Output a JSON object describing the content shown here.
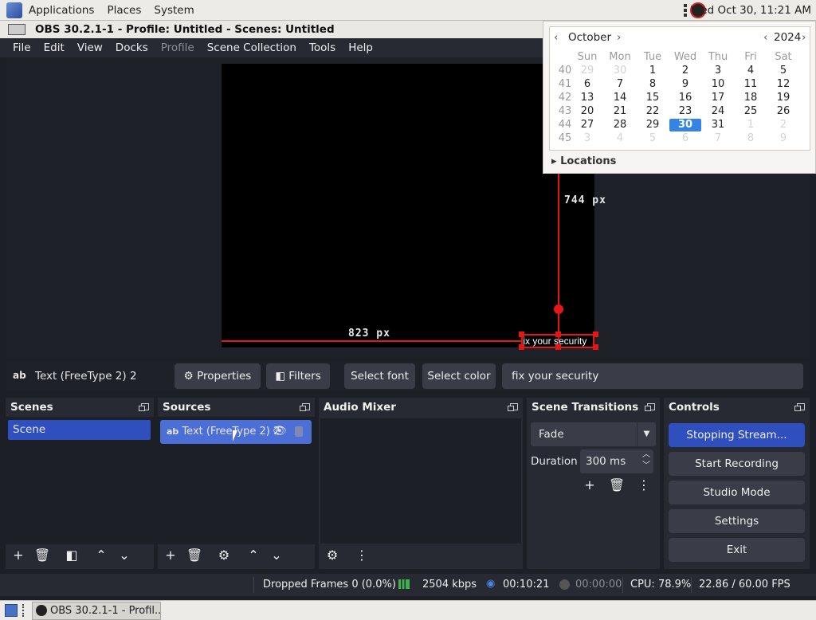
{
  "top_panel": {
    "menus": [
      "Applications",
      "Places",
      "System"
    ],
    "clock": "Wed Oct 30, 11:21 AM"
  },
  "window": {
    "title": "OBS 30.2.1-1 - Profile: Untitled - Scenes: Untitled",
    "menu": [
      {
        "label": "File",
        "disabled": false
      },
      {
        "label": "Edit",
        "disabled": false
      },
      {
        "label": "View",
        "disabled": false
      },
      {
        "label": "Docks",
        "disabled": false
      },
      {
        "label": "Profile",
        "disabled": true
      },
      {
        "label": "Scene Collection",
        "disabled": false
      },
      {
        "label": "Tools",
        "disabled": false
      },
      {
        "label": "Help",
        "disabled": false
      }
    ]
  },
  "preview": {
    "height_label": "744 px",
    "width_label": "823 px",
    "selected_text": "fix your security"
  },
  "calendar": {
    "month": "October",
    "year": "2024",
    "weekdays": [
      "Sun",
      "Mon",
      "Tue",
      "Wed",
      "Thu",
      "Fri",
      "Sat"
    ],
    "weeks": [
      {
        "num": "40",
        "days": [
          "29",
          "30",
          "1",
          "2",
          "3",
          "4",
          "5"
        ]
      },
      {
        "num": "41",
        "days": [
          "6",
          "7",
          "8",
          "9",
          "10",
          "11",
          "12"
        ]
      },
      {
        "num": "42",
        "days": [
          "13",
          "14",
          "15",
          "16",
          "17",
          "18",
          "19"
        ]
      },
      {
        "num": "43",
        "days": [
          "20",
          "21",
          "22",
          "23",
          "24",
          "25",
          "26"
        ]
      },
      {
        "num": "44",
        "days": [
          "27",
          "28",
          "29",
          "30",
          "31",
          "1",
          "2"
        ]
      },
      {
        "num": "45",
        "days": [
          "3",
          "4",
          "5",
          "6",
          "7",
          "8",
          "9"
        ]
      }
    ],
    "selected_day": "30",
    "locations_label": "Locations"
  },
  "context_bar": {
    "source_icon": "ab",
    "source_name": "Text (FreeType 2) 2",
    "properties": "Properties",
    "filters": "Filters",
    "select_font": "Select font",
    "select_color": "Select color",
    "text_value": "fix your security"
  },
  "docks": {
    "scenes": {
      "title": "Scenes",
      "items": [
        "Scene"
      ]
    },
    "sources": {
      "title": "Sources",
      "items": [
        {
          "icon": "ab",
          "label": "Text (FreeType 2) 2"
        }
      ]
    },
    "audio": {
      "title": "Audio Mixer"
    },
    "transitions": {
      "title": "Scene Transitions",
      "selected": "Fade",
      "duration_label": "Duration",
      "duration_value": "300 ms"
    },
    "controls": {
      "title": "Controls",
      "buttons": [
        "Stopping Stream...",
        "Start Recording",
        "Studio Mode",
        "Settings",
        "Exit"
      ],
      "active_color": "#2f4fbf"
    }
  },
  "status": {
    "dropped": "Dropped Frames 0 (0.0%)",
    "bitrate": "2504 kbps",
    "stream_time": "00:10:21",
    "rec_time": "00:00:00",
    "cpu": "CPU: 78.9%",
    "fps": "22.86 / 60.00 FPS"
  },
  "taskbar": {
    "item": "OBS 30.2.1-1 - Profil..."
  },
  "colors": {
    "accent": "#3584e4",
    "selection_red": "#e41616",
    "list_selected": "#2f4fbf",
    "sources_selected": "#4c6ed7"
  }
}
